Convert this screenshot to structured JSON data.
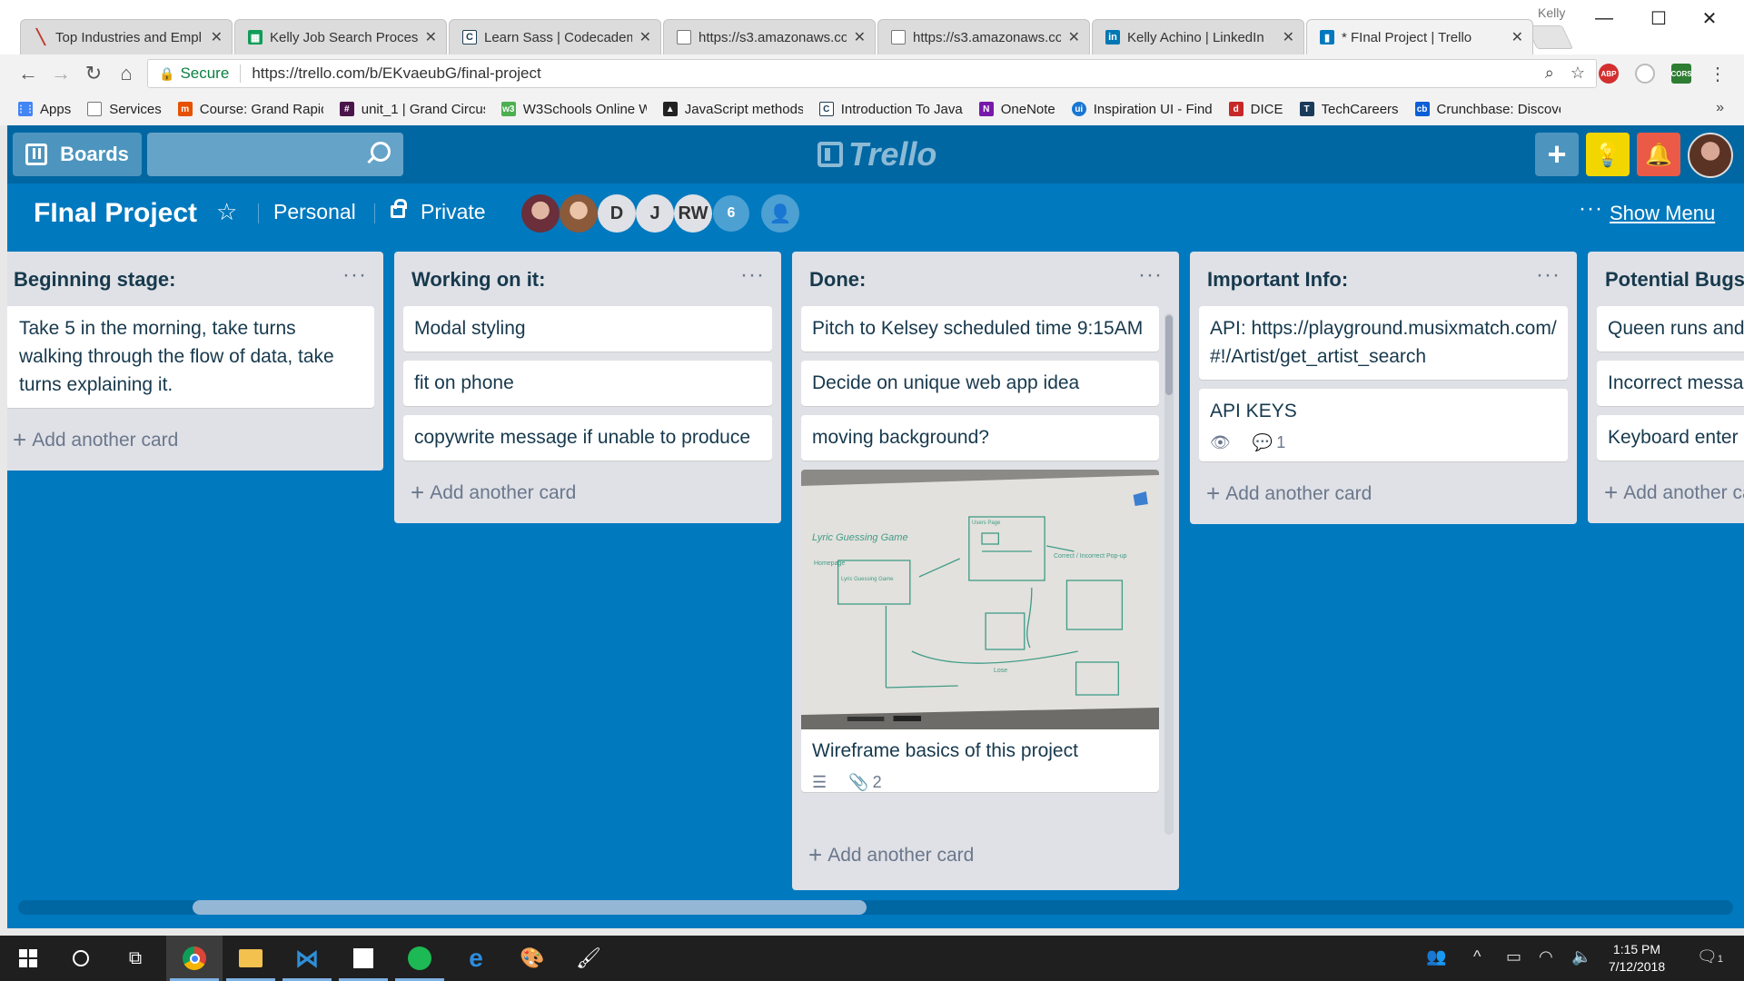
{
  "browser": {
    "profile": "Kelly",
    "tabs": [
      {
        "title": "Top Industries and Empl",
        "icon": "red-slash-icon",
        "color": "#c0392b"
      },
      {
        "title": "Kelly Job Search Process",
        "icon": "sheets-icon",
        "color": "#0f9d58"
      },
      {
        "title": "Learn Sass | Codecadem",
        "icon": "codecademy-icon",
        "color": "#1f4056"
      },
      {
        "title": "https://s3.amazonaws.co",
        "icon": "page-icon",
        "color": "#777777"
      },
      {
        "title": "https://s3.amazonaws.co",
        "icon": "page-icon",
        "color": "#777777"
      },
      {
        "title": "Kelly Achino | LinkedIn",
        "icon": "linkedin-icon",
        "color": "#0077b5"
      },
      {
        "title": "* FInal Project | Trello",
        "icon": "trello-icon",
        "color": "#0079bf"
      }
    ],
    "secure_label": "Secure",
    "url": "https://trello.com/b/EKvaeubG/final-project",
    "extensions": [
      {
        "label": "ABP",
        "color": "#d32f2f"
      },
      {
        "label": "",
        "color": "#bdbdbd"
      },
      {
        "label": "CORS",
        "color": "#2e7d32"
      }
    ],
    "bookmarks": [
      {
        "label": "Apps",
        "icon": "apps-grid-icon",
        "color": "#4285f4"
      },
      {
        "label": "Services",
        "icon": "page-icon",
        "color": "#777777"
      },
      {
        "label": "Course: Grand Rapid",
        "icon": "grand-circus-icon",
        "color": "#e65100"
      },
      {
        "label": "unit_1 | Grand Circus",
        "icon": "slack-icon",
        "color": "#4a154b"
      },
      {
        "label": "W3Schools Online W",
        "icon": "w3schools-icon",
        "color": "#4caf50"
      },
      {
        "label": "JavaScript methods",
        "icon": "graduation-cap-icon",
        "color": "#222222"
      },
      {
        "label": "Introduction To Java",
        "icon": "codecademy-icon",
        "color": "#1f4056"
      },
      {
        "label": "OneNote",
        "icon": "onenote-icon",
        "color": "#7719aa"
      },
      {
        "label": "Inspiration UI - Find",
        "icon": "ui-icon",
        "color": "#1976d2"
      },
      {
        "label": "DICE",
        "icon": "dice-icon",
        "color": "#c62828"
      },
      {
        "label": "TechCareers",
        "icon": "techcareers-icon",
        "color": "#1a3a5a"
      },
      {
        "label": "Crunchbase: Discove",
        "icon": "crunchbase-icon",
        "color": "#0a5ed7"
      }
    ]
  },
  "trello": {
    "colors": {
      "board": "#0079bf",
      "header": "#0067a3",
      "list": "#dfe1e6",
      "idea": "#f2d600",
      "notify": "#eb5a46"
    },
    "boards_label": "Boards",
    "logo_text": "Trello",
    "board_title": "FInal Project",
    "team": "Personal",
    "visibility": "Private",
    "members": [
      "",
      "",
      "D",
      "J",
      "RW"
    ],
    "member_count": "6",
    "show_menu": "Show Menu",
    "add_card_label": "Add another card",
    "lists": [
      {
        "title": "Beginning stage:",
        "cards": [
          {
            "text": "Take 5 in the morning, take turns walking through the flow of data, take turns explaining it."
          }
        ]
      },
      {
        "title": "Working on it:",
        "cards": [
          {
            "text": "Modal styling"
          },
          {
            "text": "fit on phone"
          },
          {
            "text": "copywrite message if unable to produce"
          }
        ]
      },
      {
        "title": "Done:",
        "cards": [
          {
            "text": "Pitch to Kelsey scheduled time 9:15AM"
          },
          {
            "text": "Decide on unique web app idea"
          },
          {
            "text": "moving background?"
          },
          {
            "text": "Wireframe basics of this project",
            "attachments": "2"
          }
        ],
        "whiteboard_notes": [
          "Lyric Guessing Game",
          "Homepage",
          "Lyric Guessing Game",
          "Users Page",
          "Correct / Incorrect Pop-up",
          "Lose"
        ]
      },
      {
        "title": "Important Info:",
        "cards": [
          {
            "text": "API: https://playground.musixmatch.com/#!/Artist/get_artist_search"
          },
          {
            "text": "API KEYS",
            "comments": "1"
          }
        ]
      },
      {
        "title": "Potential Bugs",
        "cards": [
          {
            "text": "Queen runs and with the name of song"
          },
          {
            "text": "Incorrect message"
          },
          {
            "text": "Keyboard enter"
          }
        ]
      }
    ]
  },
  "taskbar": {
    "time": "1:15 PM",
    "date": "7/12/2018",
    "notifications": "1"
  }
}
